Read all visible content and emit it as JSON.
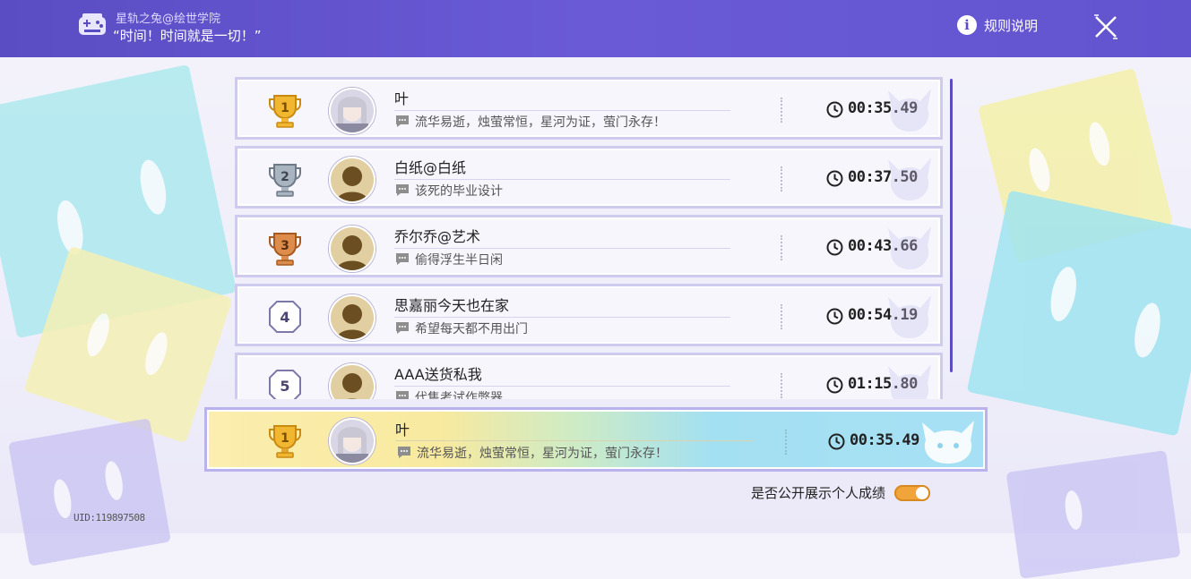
{
  "header": {
    "event_title": "星轨之兔@绘世学院",
    "quote": "“时间！时间就是一切！”",
    "rules_label": "规则说明",
    "icons": [
      "game-console-icon",
      "info-icon",
      "close-icon"
    ]
  },
  "leaderboard": {
    "rows": [
      {
        "rank": "1",
        "name": "叶",
        "message": "流华易逝，烛萤常恒，星河为证，萤门永存！",
        "time": "00:35.49",
        "medal": "gold"
      },
      {
        "rank": "2",
        "name": "白纸@白纸",
        "message": "该死的毕业设计",
        "time": "00:37.50",
        "medal": "silver"
      },
      {
        "rank": "3",
        "name": "乔尔乔@艺术",
        "message": "偷得浮生半日闲",
        "time": "00:43.66",
        "medal": "bronze"
      },
      {
        "rank": "4",
        "name": "思嘉丽今天也在家",
        "message": "希望每天都不用出门",
        "time": "00:54.19",
        "medal": "plain"
      },
      {
        "rank": "5",
        "name": "AAA送货私我",
        "message": "代售考试作弊器",
        "time": "01:15.80",
        "medal": "plain"
      }
    ]
  },
  "my_entry": {
    "rank": "1",
    "name": "叶",
    "message": "流华易逝，烛萤常恒，星河为证，萤门永存！",
    "time": "00:35.49"
  },
  "footer": {
    "toggle_label": "是否公开展示个人成绩",
    "toggle_on": true,
    "uid": "UID:119897508"
  },
  "colors": {
    "header_bg": "#5a4dc3",
    "gold": "#f2b731",
    "silver": "#9aa6b4",
    "bronze": "#d4874a",
    "toggle": "#f0a43a"
  }
}
